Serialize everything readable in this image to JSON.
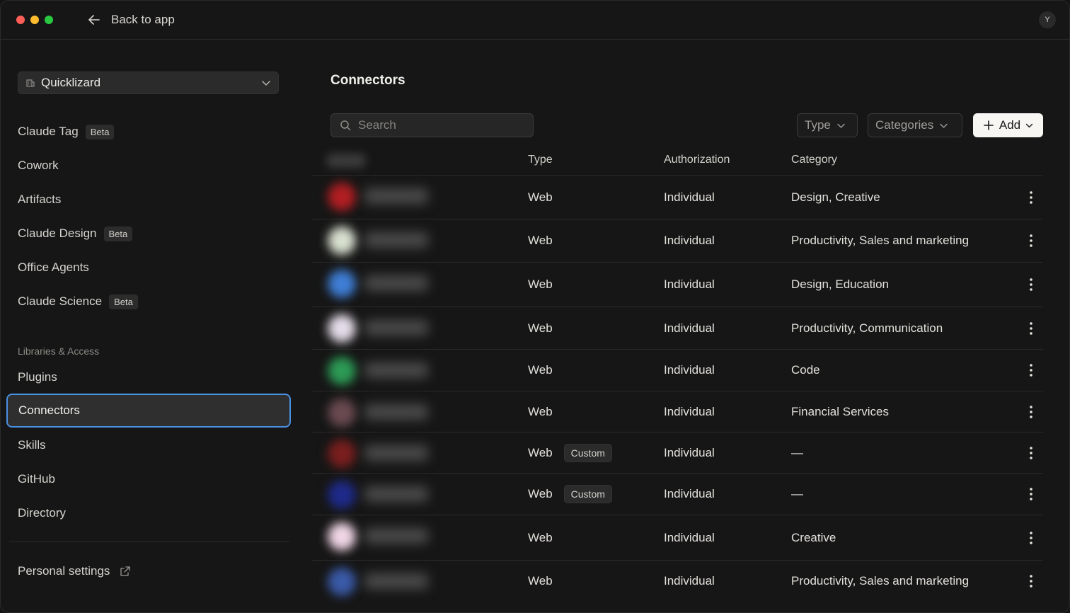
{
  "titlebar": {
    "back_label": "Back to app",
    "avatar_initial": "Y"
  },
  "sidebar": {
    "org_name": "Quicklizard",
    "items": [
      {
        "label": "Claude Tag",
        "badge": "Beta"
      },
      {
        "label": "Cowork",
        "badge": ""
      },
      {
        "label": "Artifacts",
        "badge": ""
      },
      {
        "label": "Claude Design",
        "badge": "Beta"
      },
      {
        "label": "Office Agents",
        "badge": ""
      },
      {
        "label": "Claude Science",
        "badge": "Beta"
      }
    ],
    "section_label": "Libraries & Access",
    "lib_items": [
      "Plugins",
      "Connectors",
      "Skills",
      "GitHub",
      "Directory"
    ],
    "active_item": "Connectors",
    "personal_settings": "Personal settings"
  },
  "main": {
    "title": "Connectors",
    "search_placeholder": "Search",
    "filter_type": "Type",
    "filter_categories": "Categories",
    "add_label": "Add",
    "columns": {
      "type": "Type",
      "authorization": "Authorization",
      "category": "Category"
    },
    "rows": [
      {
        "type": "Web",
        "custom": "",
        "authorization": "Individual",
        "category": "Design, Creative",
        "logo_color": "#b01e22"
      },
      {
        "type": "Web",
        "custom": "",
        "authorization": "Individual",
        "category": "Productivity, Sales and marketing",
        "logo_color": "#d8e0d0"
      },
      {
        "type": "Web",
        "custom": "",
        "authorization": "Individual",
        "category": "Design, Education",
        "logo_color": "#3f7ed6"
      },
      {
        "type": "Web",
        "custom": "",
        "authorization": "Individual",
        "category": "Productivity, Communication",
        "logo_color": "#e4dce8"
      },
      {
        "type": "Web",
        "custom": "",
        "authorization": "Individual",
        "category": "Code",
        "logo_color": "#2c9a55"
      },
      {
        "type": "Web",
        "custom": "",
        "authorization": "Individual",
        "category": "Financial Services",
        "logo_color": "#6a4a50"
      },
      {
        "type": "Web",
        "custom": "Custom",
        "authorization": "Individual",
        "category": "—",
        "logo_color": "#7a1e1e"
      },
      {
        "type": "Web",
        "custom": "Custom",
        "authorization": "Individual",
        "category": "—",
        "logo_color": "#1e2a8a"
      },
      {
        "type": "Web",
        "custom": "",
        "authorization": "Individual",
        "category": "Creative",
        "logo_color": "#f0d6e6"
      },
      {
        "type": "Web",
        "custom": "",
        "authorization": "Individual",
        "category": "Productivity, Sales and marketing",
        "logo_color": "#3a5aa8"
      }
    ]
  }
}
